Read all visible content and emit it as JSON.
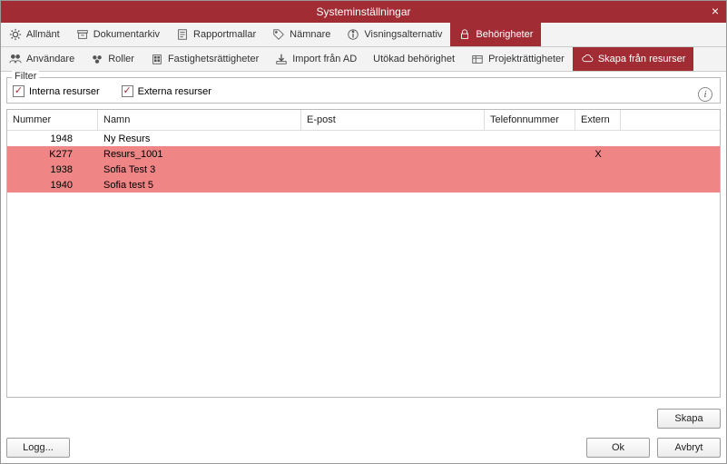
{
  "window": {
    "title": "Systeminställningar"
  },
  "tabs1": [
    {
      "label": "Allmänt",
      "icon": "gear-icon"
    },
    {
      "label": "Dokumentarkiv",
      "icon": "archive-icon"
    },
    {
      "label": "Rapportmallar",
      "icon": "report-icon"
    },
    {
      "label": "Nämnare",
      "icon": "tag-icon"
    },
    {
      "label": "Visningsalternativ",
      "icon": "info-circle-icon"
    },
    {
      "label": "Behörigheter",
      "icon": "lock-icon",
      "active": true
    }
  ],
  "tabs2": [
    {
      "label": "Användare",
      "icon": "users-icon"
    },
    {
      "label": "Roller",
      "icon": "roles-icon"
    },
    {
      "label": "Fastighetsrättigheter",
      "icon": "building-icon"
    },
    {
      "label": "Import från AD",
      "icon": "import-icon"
    },
    {
      "label": "Utökad behörighet",
      "icon": ""
    },
    {
      "label": "Projekträttigheter",
      "icon": "project-icon"
    },
    {
      "label": "Skapa från resurser",
      "icon": "cloud-icon",
      "active": true
    }
  ],
  "filter": {
    "legend": "Filter",
    "internal": "Interna resurser",
    "external": "Externa resurser"
  },
  "grid": {
    "headers": {
      "num": "Nummer",
      "name": "Namn",
      "email": "E-post",
      "phone": "Telefonnummer",
      "ext": "Extern"
    },
    "rows": [
      {
        "num": "1948",
        "name": "Ny Resurs",
        "email": "",
        "phone": "",
        "ext": "",
        "hl": false
      },
      {
        "num": "K277",
        "name": "Resurs_1001",
        "email": "",
        "phone": "",
        "ext": "X",
        "hl": true
      },
      {
        "num": "1938",
        "name": "Sofia Test 3",
        "email": "",
        "phone": "",
        "ext": "",
        "hl": true
      },
      {
        "num": "1940",
        "name": "Sofia test 5",
        "email": "",
        "phone": "",
        "ext": "",
        "hl": true
      }
    ]
  },
  "buttons": {
    "create": "Skapa",
    "log": "Logg...",
    "ok": "Ok",
    "cancel": "Avbryt"
  }
}
